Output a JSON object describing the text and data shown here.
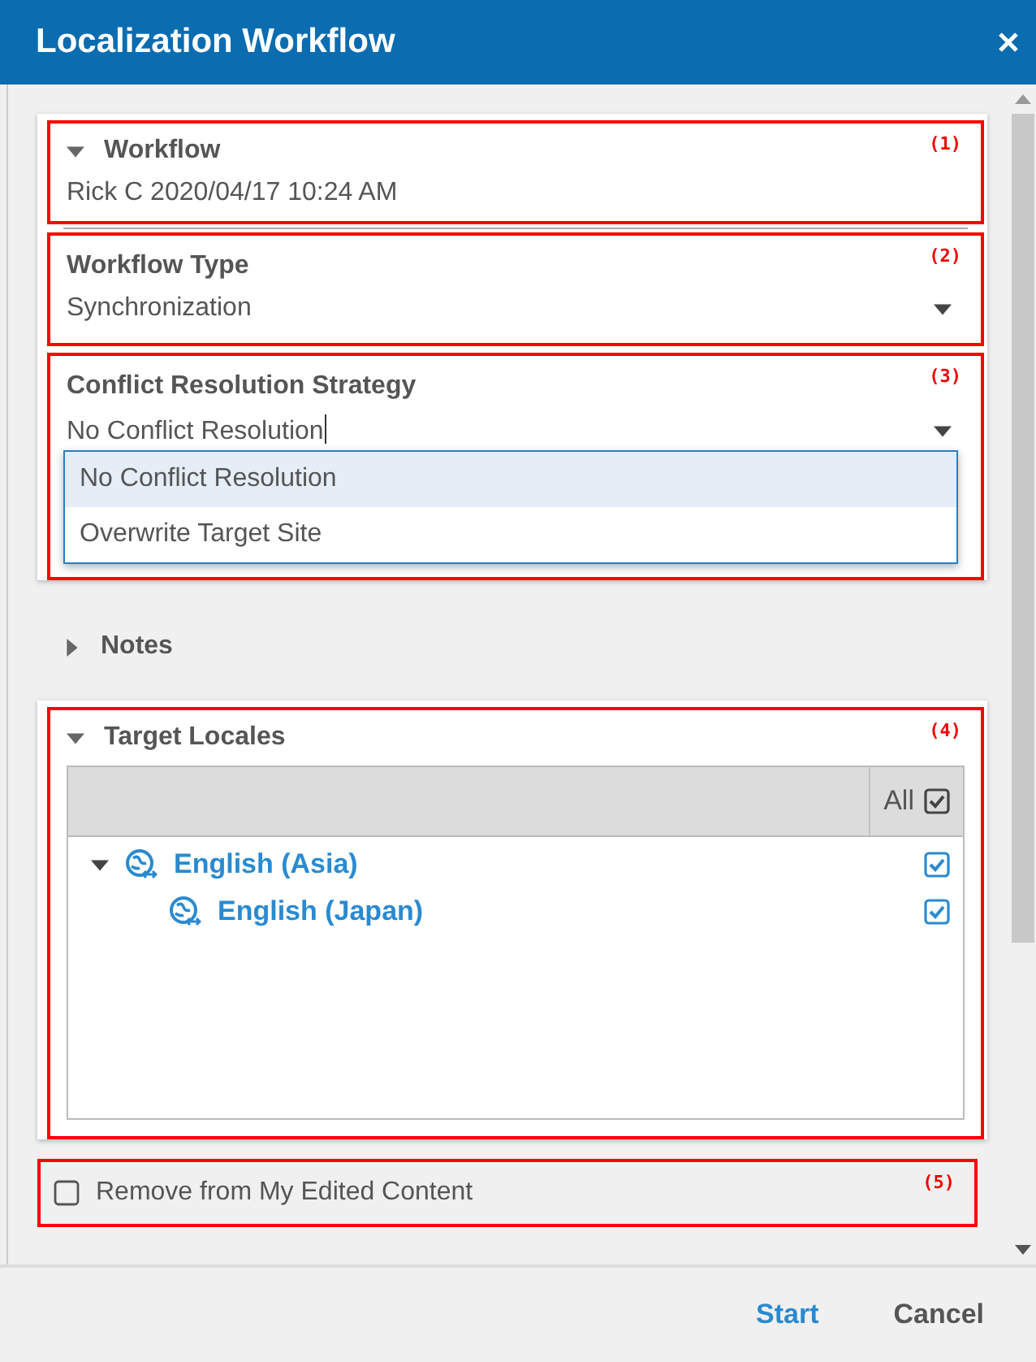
{
  "window": {
    "title": "Localization Workflow"
  },
  "workflow": {
    "title": "Workflow",
    "expanded": true,
    "value": "Rick C 2020/04/17 10:24 AM",
    "callout": "(1)"
  },
  "workflow_type": {
    "label": "Workflow Type",
    "value": "Synchronization",
    "callout": "(2)"
  },
  "conflict_strategy": {
    "label": "Conflict Resolution Strategy",
    "value": "No Conflict Resolution",
    "callout": "(3)",
    "options": [
      {
        "label": "No Conflict Resolution",
        "selected": true
      },
      {
        "label": "Overwrite Target Site",
        "selected": false
      }
    ]
  },
  "notes": {
    "title": "Notes",
    "expanded": false
  },
  "target_locales": {
    "title": "Target Locales",
    "expanded": true,
    "callout": "(4)",
    "all_label": "All",
    "all_checked": true,
    "locales": [
      {
        "name": "English (Asia)",
        "checked": true,
        "expanded": true,
        "children": [
          {
            "name": "English (Japan)",
            "checked": true
          }
        ]
      }
    ]
  },
  "remove_option": {
    "label": "Remove from My Edited Content",
    "checked": false,
    "callout": "(5)"
  },
  "buttons": [
    {
      "label": "Start",
      "kind": "primary"
    },
    {
      "label": "Cancel",
      "kind": "secondary"
    }
  ]
}
